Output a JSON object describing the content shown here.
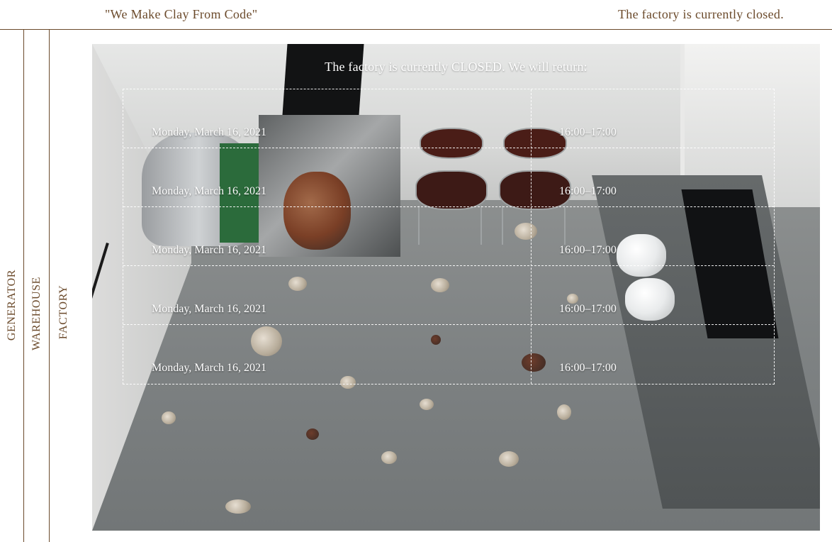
{
  "header": {
    "tagline": "\"We Make Clay From Code\"",
    "status": "The factory is currently closed."
  },
  "nav": {
    "items": [
      {
        "label": "GENERATOR"
      },
      {
        "label": "WAREHOUSE"
      },
      {
        "label": "FACTORY"
      }
    ]
  },
  "notice": {
    "title": "The factory is currently CLOSED. We will return:",
    "schedule": [
      {
        "date": "Monday, March 16, 2021",
        "time": "16:00–17:00"
      },
      {
        "date": "Monday, March 16, 2021",
        "time": "16:00–17:00"
      },
      {
        "date": "Monday, March 16, 2021",
        "time": "16:00–17:00"
      },
      {
        "date": "Monday, March 16, 2021",
        "time": "16:00–17:00"
      },
      {
        "date": "Monday, March 16, 2021",
        "time": "16:00–17:00"
      }
    ]
  },
  "colors": {
    "text": "#6b4a2b",
    "overlay_text": "#ffffff"
  }
}
